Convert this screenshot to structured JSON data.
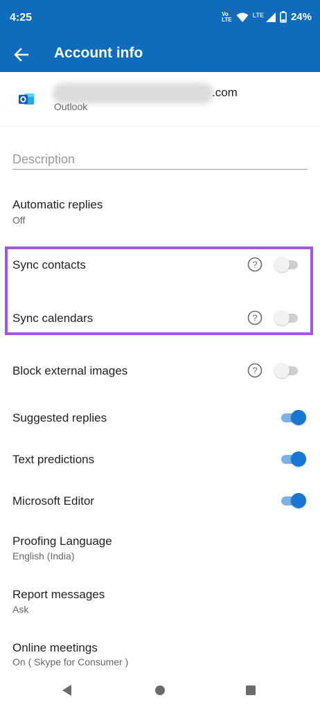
{
  "status": {
    "time": "4:25",
    "volte": [
      "Vo",
      "LTE"
    ],
    "lte": "LTE",
    "battery": "24%"
  },
  "appbar": {
    "title": "Account info",
    "back_icon": "arrow-left-icon"
  },
  "account": {
    "email_suffix": ".com",
    "type": "Outlook"
  },
  "description": {
    "placeholder": "Description"
  },
  "automatic_replies": {
    "label": "Automatic replies",
    "value": "Off"
  },
  "sync_contacts": {
    "label": "Sync contacts",
    "enabled": false
  },
  "sync_calendars": {
    "label": "Sync calendars",
    "enabled": false
  },
  "block_external_images": {
    "label": "Block external images",
    "enabled": false
  },
  "suggested_replies": {
    "label": "Suggested replies",
    "enabled": true
  },
  "text_predictions": {
    "label": "Text predictions",
    "enabled": true
  },
  "microsoft_editor": {
    "label": "Microsoft Editor",
    "enabled": true
  },
  "proofing_language": {
    "label": "Proofing Language",
    "value": "English (India)"
  },
  "report_messages": {
    "label": "Report messages",
    "value": "Ask"
  },
  "online_meetings": {
    "label": "Online meetings",
    "value": "On ( Skype for Consumer )"
  },
  "colors": {
    "brand": "#0f6cbd",
    "toggle_on": "#1976d2",
    "highlight": "#a356e6"
  }
}
